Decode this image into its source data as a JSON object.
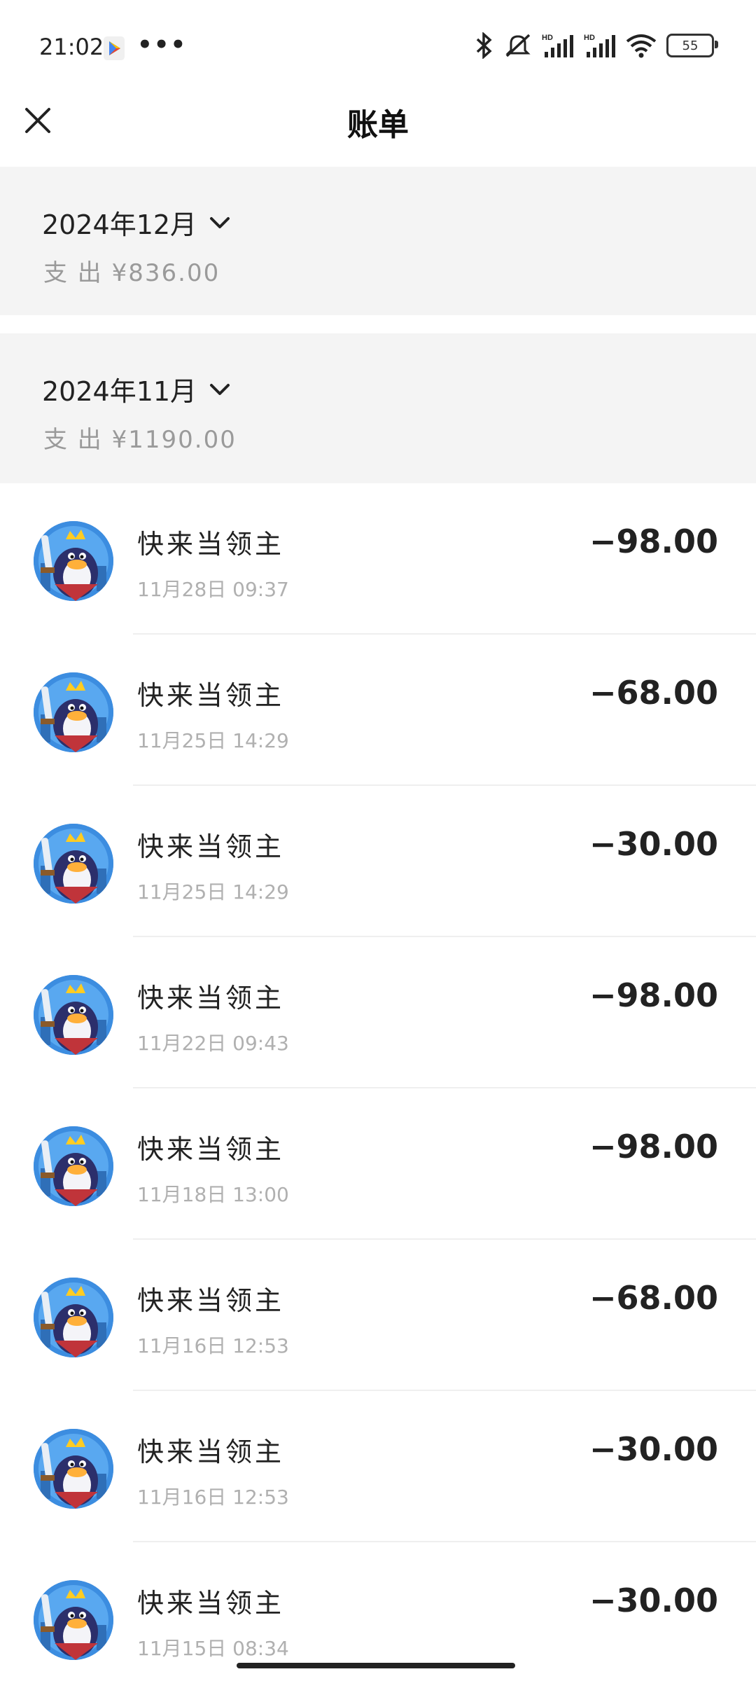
{
  "status_bar": {
    "time": "21:02",
    "dots": "•••",
    "battery": "55"
  },
  "header": {
    "title": "账单"
  },
  "months": [
    {
      "title": "2024年12月",
      "summary": "支 出 ¥836.00"
    },
    {
      "title": "2024年11月",
      "summary": "支 出 ¥1190.00"
    }
  ],
  "transactions": [
    {
      "name": "快来当领主",
      "time": "11月28日  09:37",
      "amount": "−98.00"
    },
    {
      "name": "快来当领主",
      "time": "11月25日  14:29",
      "amount": "−68.00"
    },
    {
      "name": "快来当领主",
      "time": "11月25日  14:29",
      "amount": "−30.00"
    },
    {
      "name": "快来当领主",
      "time": "11月22日  09:43",
      "amount": "−98.00"
    },
    {
      "name": "快来当领主",
      "time": "11月18日  13:00",
      "amount": "−98.00"
    },
    {
      "name": "快来当领主",
      "time": "11月16日  12:53",
      "amount": "−68.00"
    },
    {
      "name": "快来当领主",
      "time": "11月16日  12:53",
      "amount": "−30.00"
    },
    {
      "name": "快来当领主",
      "time": "11月15日  08:34",
      "amount": "−30.00"
    }
  ]
}
